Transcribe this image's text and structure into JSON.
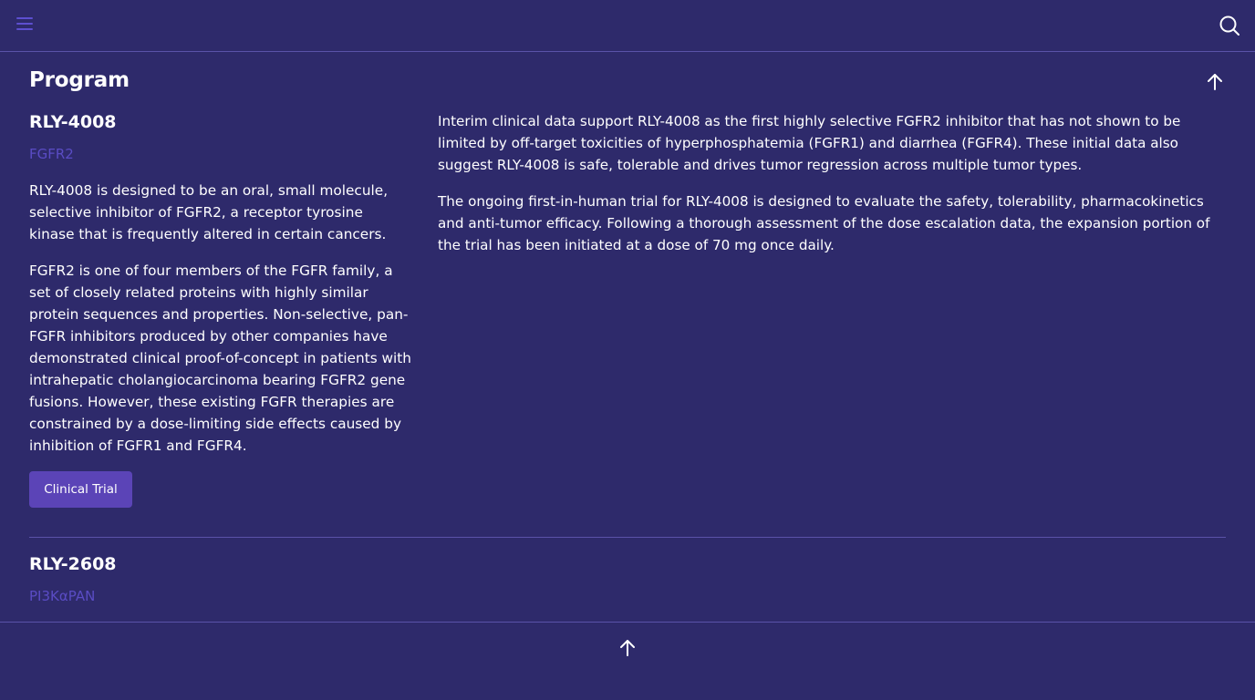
{
  "header": {
    "menu_icon": "hamburger-menu-icon",
    "search_icon": "search-icon"
  },
  "section": {
    "title": "Program",
    "scroll_top_icon": "arrow-up-icon"
  },
  "programs": [
    {
      "name": "RLY-4008",
      "target": "FGFR2",
      "left_paragraphs": [
        "RLY-4008 is designed to be an oral, small molecule, selective inhibitor of FGFR2, a receptor tyrosine kinase that is frequently altered in certain cancers.",
        "FGFR2 is one of four members of the FGFR family, a set of closely related proteins with highly similar protein sequences and properties. Non-selective, pan-FGFR inhibitors produced by other companies have demonstrated clinical proof-of-concept in patients with intrahepatic cholangiocarcinoma bearing FGFR2 gene fusions. However, these existing FGFR therapies are constrained by a dose-limiting side effects caused by inhibition of FGFR1 and FGFR4."
      ],
      "right_paragraphs": [
        "Interim clinical data support RLY-4008 as the first highly selective FGFR2 inhibitor that has not shown to be limited by off-target toxicities of hyperphosphatemia (FGFR1) and diarrhea (FGFR4). These initial data also suggest RLY-4008 is safe, tolerable and drives tumor regression across multiple tumor types.",
        "The ongoing first-in-human trial for RLY-4008 is designed to evaluate the safety, tolerability, pharmacokinetics and anti-tumor efficacy. Following a thorough assessment of the dose escalation data, the expansion portion of the trial has been initiated at a dose of 70 mg once daily."
      ],
      "button_label": "Clinical Trial"
    },
    {
      "name": "RLY-2608",
      "target": "PI3KαPAN"
    }
  ],
  "footer": {
    "scroll_top_icon": "arrow-up-icon"
  },
  "colors": {
    "background": "#2e2a6b",
    "accent": "#5b44b7",
    "target_text": "#5a4cc4",
    "divider": "#5a52a8"
  }
}
